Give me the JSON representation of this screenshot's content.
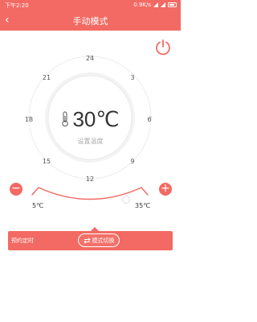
{
  "status_bar": {
    "time": "下午2:20",
    "network_speed": "0.9K/s",
    "battery_icon": "battery-icon"
  },
  "header": {
    "title": "手动模式",
    "back_icon": "back-chevron-icon"
  },
  "dial": {
    "ticks": [
      "24",
      "3",
      "6",
      "9",
      "12",
      "15",
      "18",
      "21"
    ],
    "temperature": "30℃",
    "label": "设置温度",
    "thermometer_icon": "thermometer-icon"
  },
  "range": {
    "min_label": "5℃",
    "max_label": "35℃",
    "minus": "−",
    "plus": "+"
  },
  "bottom": {
    "schedule_label": "预约定时",
    "mode_switch_label": "模式切换"
  },
  "colors": {
    "accent": "#f26a63"
  }
}
